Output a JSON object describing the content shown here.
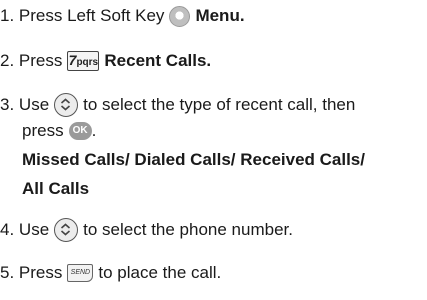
{
  "steps": [
    {
      "num": "1.",
      "pre": "Press Left Soft Key",
      "bold": "Menu."
    },
    {
      "num": "2.",
      "pre": "Press",
      "bold": "Recent Calls."
    },
    {
      "num": "3.",
      "pre": "Use",
      "post": "to select the type of recent call, then"
    },
    {
      "num": "",
      "pre": "press",
      "post": "."
    },
    {
      "num": "4.",
      "pre": "Use",
      "post": "to select the phone number."
    },
    {
      "num": "5.",
      "pre": "Press",
      "post": "to place the call."
    }
  ],
  "options": {
    "line1": "Missed Calls/ Dialed Calls/ Received Calls/",
    "line2": "All Calls"
  },
  "keys": {
    "seven": {
      "digit": "7",
      "letters": "pqrs"
    },
    "ok": "OK",
    "send": "SEND"
  },
  "icons": [
    "left-soft-key-icon",
    "seven-key-icon",
    "navigation-key-icon",
    "ok-key-icon",
    "send-key-icon"
  ]
}
